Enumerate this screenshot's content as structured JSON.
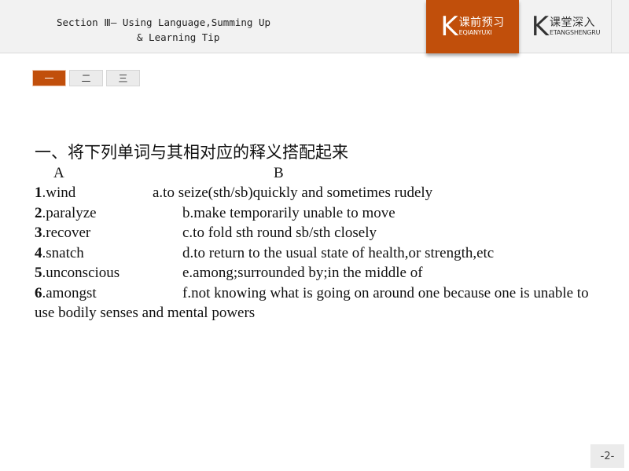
{
  "header": {
    "title_line1": "Section Ⅲ— Using Language,Summing Up",
    "title_line2": "& Learning Tip",
    "nav": [
      {
        "k": "K",
        "cn": "课前预习",
        "pinyin": "EQIANYUXI",
        "active": true
      },
      {
        "k": "K",
        "cn": "课堂深入",
        "pinyin": "ETANGSHENGRU",
        "active": false
      }
    ]
  },
  "pager": [
    "一",
    "二",
    "三"
  ],
  "content": {
    "title": "一、将下列单词与其相对应的释义搭配起来",
    "col_a": "A",
    "col_b": "B",
    "items": [
      {
        "num": "1",
        "word": ".wind",
        "def": "a.to seize(sth/sb)quickly and sometimes rudely"
      },
      {
        "num": "2",
        "word": ".paralyze",
        "def": "b.make temporarily unable to move"
      },
      {
        "num": "3",
        "word": ".recover",
        "def": "c.to fold sth round sb/sth closely"
      },
      {
        "num": "4",
        "word": ".snatch",
        "def": "d.to return to the usual state of health,or strength,etc"
      },
      {
        "num": "5",
        "word": ".unconscious",
        "def": "e.among;surrounded by;in the middle of"
      },
      {
        "num": "6",
        "word": ".amongst",
        "def": "f.not knowing what is going on around one because one is unable to use bodily senses and mental powers"
      }
    ]
  },
  "page_number": "-2-",
  "colors": {
    "accent": "#c14f0b",
    "header_bg": "#f2f2f2"
  }
}
